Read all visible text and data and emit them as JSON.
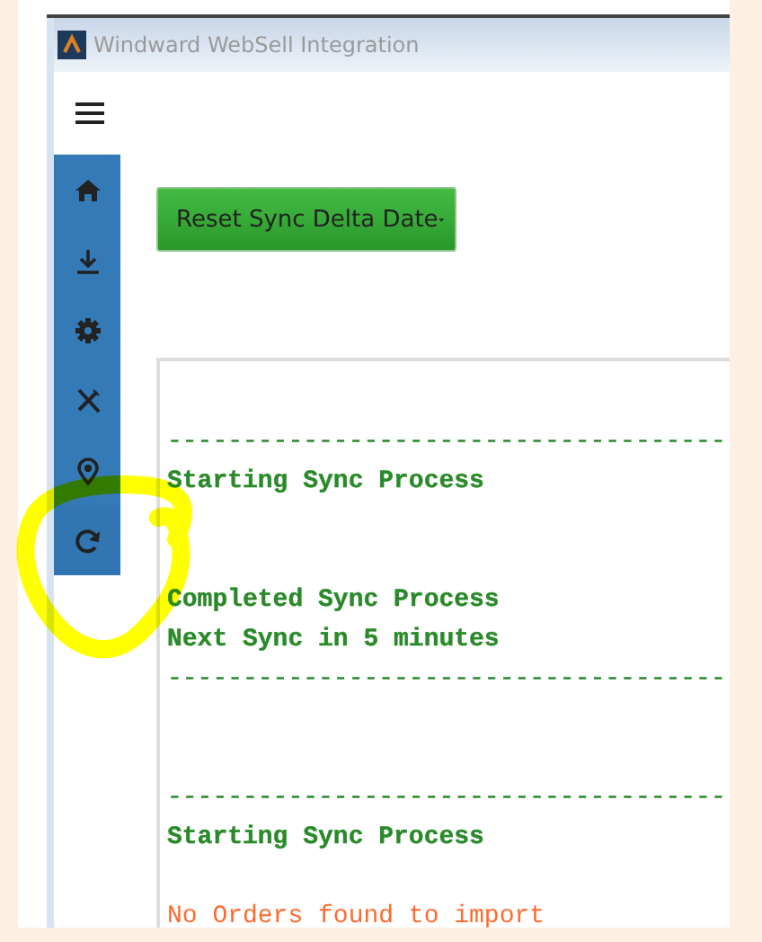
{
  "window": {
    "title": "Windward WebSell Integration"
  },
  "sidebar": {
    "items": [
      {
        "kind": "home"
      },
      {
        "kind": "download"
      },
      {
        "kind": "settings"
      },
      {
        "kind": "tools"
      },
      {
        "kind": "location"
      },
      {
        "kind": "sync"
      }
    ]
  },
  "action_button": {
    "label": "Reset Sync Delta Date"
  },
  "log": {
    "lines": [
      {
        "kind": "blank"
      },
      {
        "kind": "rule",
        "text": "-------------------------------------"
      },
      {
        "kind": "info",
        "text": "Starting Sync Process"
      },
      {
        "kind": "blank"
      },
      {
        "kind": "blank"
      },
      {
        "kind": "info",
        "text": "Completed Sync Process"
      },
      {
        "kind": "info",
        "text": "Next Sync in 5 minutes"
      },
      {
        "kind": "rule",
        "text": "-------------------------------------"
      },
      {
        "kind": "blank"
      },
      {
        "kind": "blank"
      },
      {
        "kind": "rule",
        "text": "-------------------------------------"
      },
      {
        "kind": "info",
        "text": "Starting Sync Process"
      },
      {
        "kind": "blank"
      },
      {
        "kind": "warning",
        "text": "No Orders found to import"
      }
    ]
  }
}
